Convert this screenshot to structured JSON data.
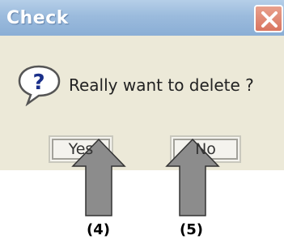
{
  "dialog": {
    "title": "Check",
    "message": "Really want to delete ?",
    "icon": "question-icon",
    "close_icon": "close-icon",
    "buttons": {
      "yes_label": "Yes",
      "no_label": "No"
    }
  },
  "annotations": {
    "step_4": "(4)",
    "step_5": "(5)"
  },
  "colors": {
    "titlebar": "#9bbbdd",
    "dialog_background": "#ece9d8",
    "close_button": "#d97560",
    "arrow": "#8c8c8c"
  }
}
